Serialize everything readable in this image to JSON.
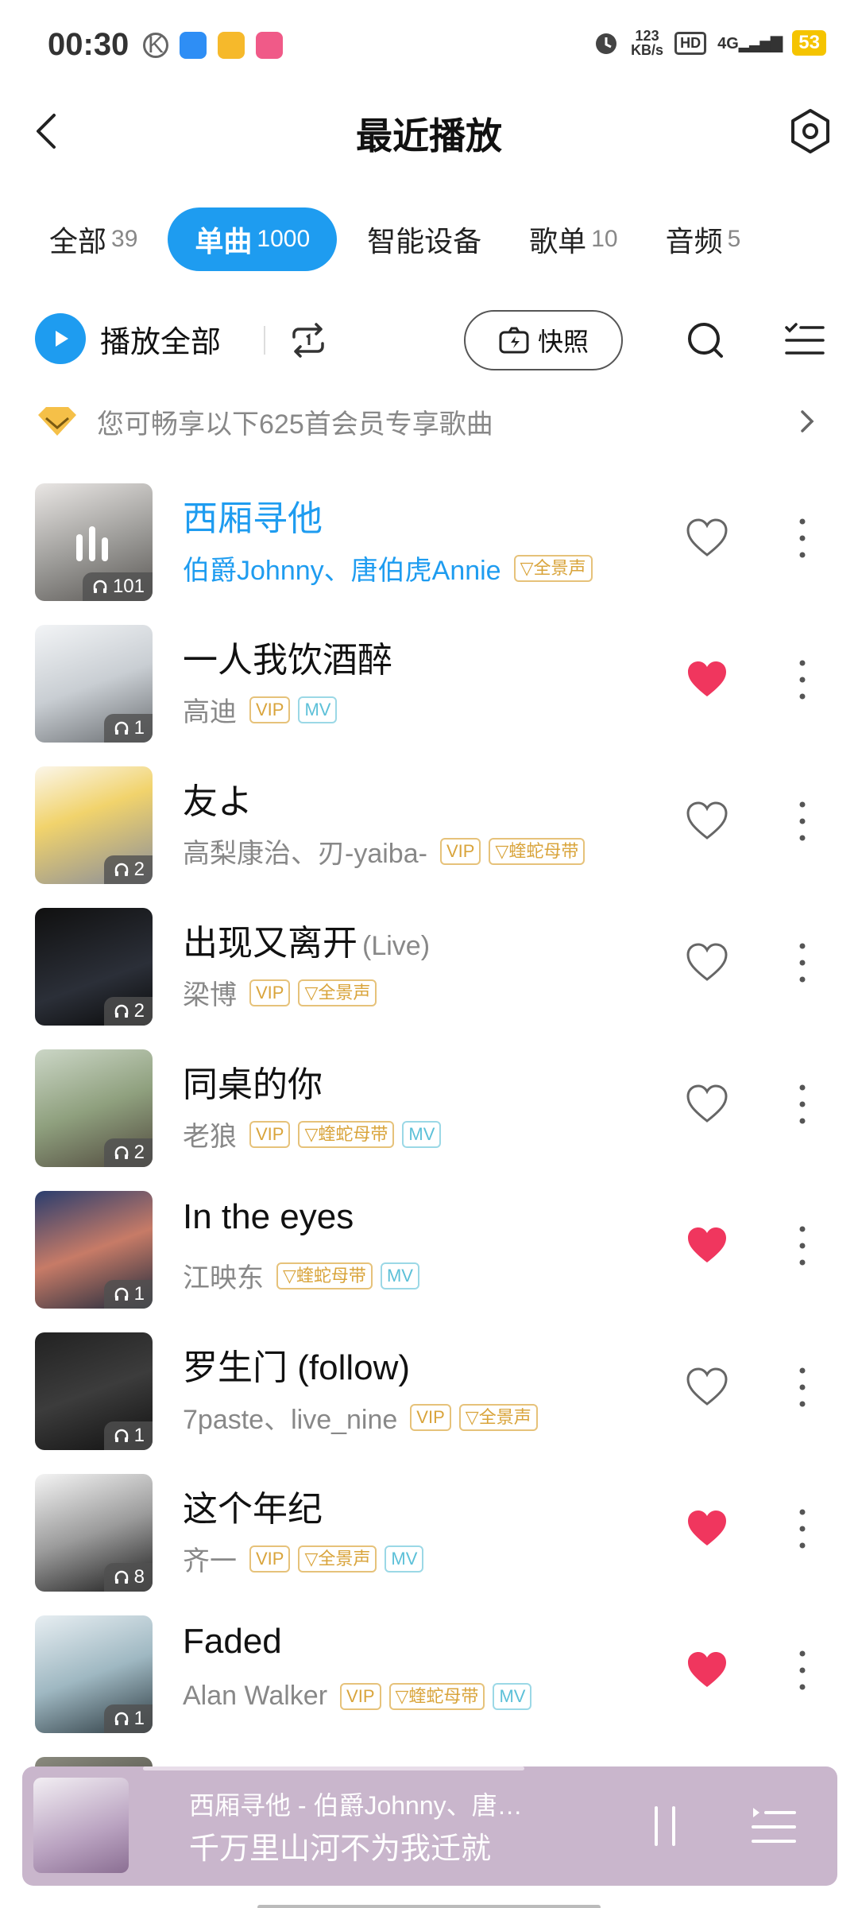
{
  "status": {
    "time": "00:30",
    "speed_value": "123",
    "speed_unit": "KB/s",
    "hd": "HD",
    "network": "4G",
    "battery": "53"
  },
  "header": {
    "title": "最近播放"
  },
  "tabs": [
    {
      "label": "全部",
      "count": "39"
    },
    {
      "label": "单曲",
      "count": "1000",
      "active": true
    },
    {
      "label": "智能设备",
      "count": ""
    },
    {
      "label": "歌单",
      "count": "10"
    },
    {
      "label": "音频",
      "count": "5"
    }
  ],
  "toolbar": {
    "play_all": "播放全部",
    "snapshot": "快照"
  },
  "vip_banner": {
    "text": "您可畅享以下625首会员专享歌曲"
  },
  "songs": [
    {
      "title": "西厢寻他",
      "version": "",
      "artist": "伯爵Johnny、唐伯虎Annie",
      "tags": [
        "全景声"
      ],
      "plays": "101",
      "liked": false,
      "playing": true
    },
    {
      "title": "一人我饮酒醉",
      "version": "",
      "artist": "高迪",
      "tags": [
        "VIP",
        "MV"
      ],
      "plays": "1",
      "liked": true
    },
    {
      "title": "友よ",
      "version": "",
      "artist": "高梨康治、刃-yaiba-",
      "tags": [
        "VIP",
        "蝰蛇母带"
      ],
      "plays": "2",
      "liked": false
    },
    {
      "title": "出现又离开",
      "version": "(Live)",
      "artist": "梁博",
      "tags": [
        "VIP",
        "全景声"
      ],
      "plays": "2",
      "liked": false
    },
    {
      "title": "同桌的你",
      "version": "",
      "artist": "老狼",
      "tags": [
        "VIP",
        "蝰蛇母带",
        "MV"
      ],
      "plays": "2",
      "liked": false
    },
    {
      "title": "In the eyes",
      "version": "",
      "artist": "江映东",
      "tags": [
        "蝰蛇母带",
        "MV"
      ],
      "plays": "1",
      "liked": true
    },
    {
      "title": "罗生门 (follow)",
      "version": "",
      "artist": "7paste、live_nine",
      "tags": [
        "VIP",
        "全景声"
      ],
      "plays": "1",
      "liked": false
    },
    {
      "title": "这个年纪",
      "version": "",
      "artist": "齐一",
      "tags": [
        "VIP",
        "全景声",
        "MV"
      ],
      "plays": "8",
      "liked": true
    },
    {
      "title": "Faded",
      "version": "",
      "artist": "Alan Walker",
      "tags": [
        "VIP",
        "蝰蛇母带",
        "MV"
      ],
      "plays": "1",
      "liked": true
    }
  ],
  "player": {
    "now_playing": "西厢寻他  -  伯爵Johnny、唐…",
    "lyric": "千万里山河不为我迁就"
  },
  "colors": {
    "accent": "#1e9cf0",
    "liked": "#f0365e",
    "player_bg": "#c9b6cc"
  },
  "icons": [
    "back-arrow-icon",
    "settings-hexagon-icon",
    "play-icon",
    "loop-icon",
    "snapshot-camera-icon",
    "search-icon",
    "multi-select-icon",
    "vip-diamond-icon",
    "chevron-right-icon",
    "heart-icon",
    "more-vertical-icon",
    "pause-icon",
    "playlist-queue-icon",
    "headphones-icon"
  ]
}
